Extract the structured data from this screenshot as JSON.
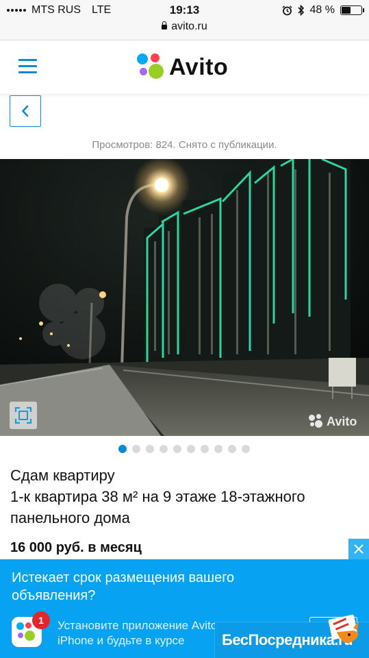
{
  "status_bar": {
    "carrier": "MTS RUS",
    "network": "LTE",
    "time": "19:13",
    "battery": "48 %",
    "battery_level": 0.48,
    "url": "avito.ru"
  },
  "header": {
    "logo_text": "Avito",
    "logo_colors": [
      "#01aaff",
      "#ff4053",
      "#97cf26",
      "#a169f7"
    ]
  },
  "listing": {
    "views_text": "Просмотров: 824. Снято с публикации.",
    "photo_watermark": "Avito",
    "photo_count": 10,
    "active_photo_index": 0,
    "title_line1": "Сдам квартиру",
    "title_line2": "1-к квартира 38 м² на 9 этаже 18-этажного панельного дома",
    "price": "16 000 руб. в месяц"
  },
  "banner": {
    "headline": "Истекает срок размещения вашего объявления?",
    "badge_count": "1",
    "install_text": "Установите приложение Avito для iPhone и будьте в курсе",
    "background": "#08a2f3"
  },
  "overlay": {
    "brand_text": "БесПосредника",
    "brand_suffix": ".ru"
  },
  "colors": {
    "accent": "#0a8ad8",
    "dot_inactive": "#d9d9d9",
    "badge": "#e2262c"
  }
}
